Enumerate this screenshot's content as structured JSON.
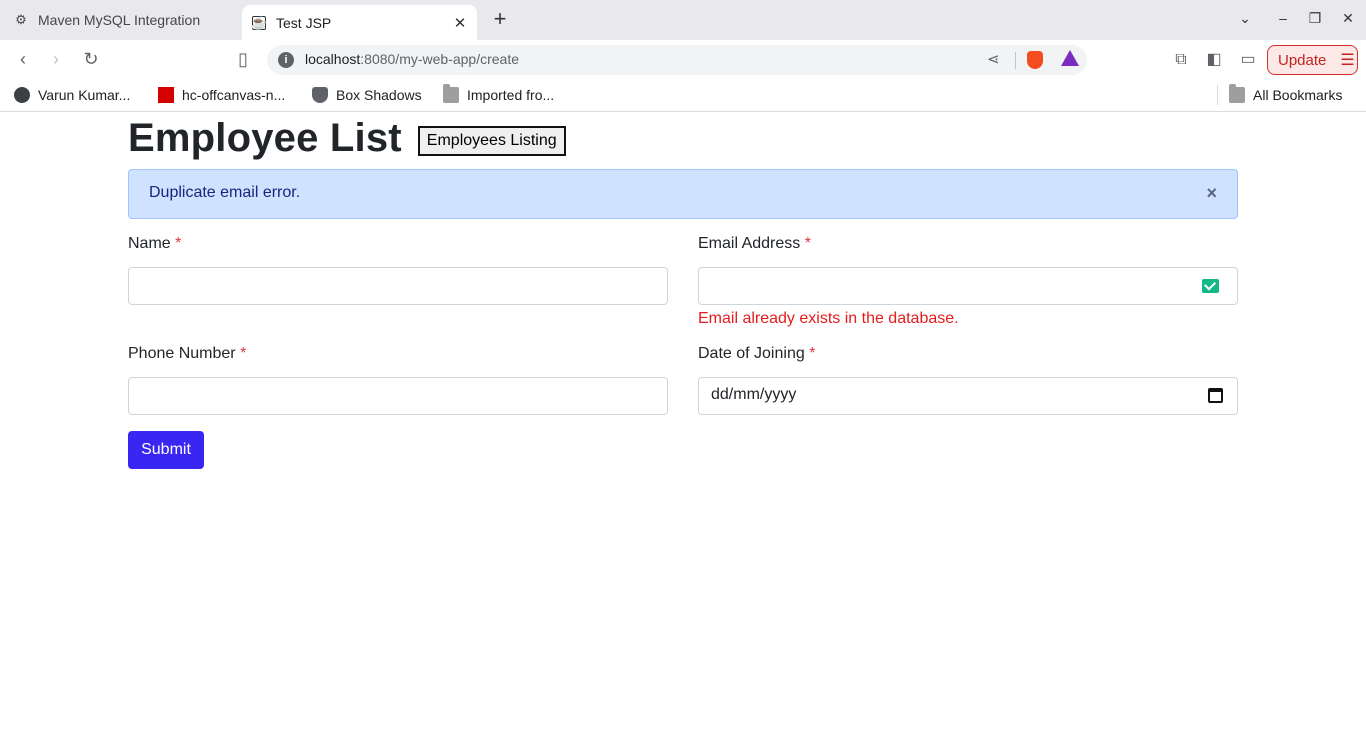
{
  "browser": {
    "tabs": [
      {
        "title": "Maven MySQL Integration",
        "active": false
      },
      {
        "title": "Test JSP",
        "active": true
      }
    ],
    "address": {
      "host": "localhost",
      "path": ":8080/my-web-app/create"
    },
    "update_label": "Update",
    "bookmarks": [
      {
        "label": "Varun Kumar...",
        "icon": "globe-icon"
      },
      {
        "label": "hc-offcanvas-n...",
        "icon": "npm-icon"
      },
      {
        "label": "Box Shadows",
        "icon": "shield-icon"
      },
      {
        "label": "Imported fro...",
        "icon": "folder-icon"
      }
    ],
    "all_bookmarks_label": "All Bookmarks"
  },
  "page": {
    "title": "Employee List",
    "listing_button": "Employees Listing",
    "alert": {
      "message": "Duplicate email error.",
      "close": "×"
    },
    "form": {
      "name": {
        "label": "Name",
        "required": "*",
        "value": ""
      },
      "email": {
        "label": "Email Address",
        "required": "*",
        "value": "",
        "error": "Email already exists in the database."
      },
      "phone": {
        "label": "Phone Number",
        "required": "*",
        "value": ""
      },
      "doj": {
        "label": "Date of Joining",
        "required": "*",
        "placeholder": "dd/mm/yyyy"
      },
      "submit": "Submit"
    }
  },
  "colors": {
    "alert_bg": "#cfe2ff",
    "submit_bg": "#3a26f2",
    "error": "#e41c1c",
    "required": "#dc3545"
  }
}
